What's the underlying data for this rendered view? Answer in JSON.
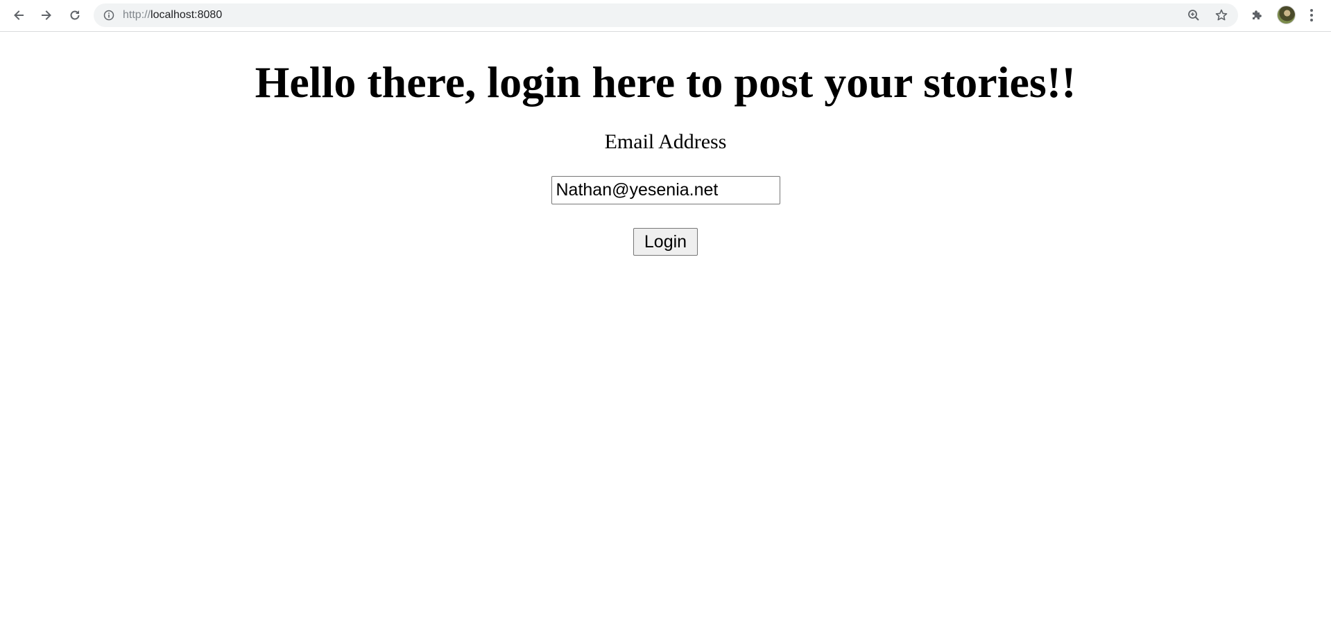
{
  "browser": {
    "url_prefix": "http://",
    "url_host": "localhost:8080",
    "icons": {
      "back": "arrow-left-icon",
      "forward": "arrow-right-icon",
      "reload": "reload-icon",
      "site_info": "info-icon",
      "zoom": "zoom-icon",
      "bookmark": "star-icon",
      "extensions": "puzzle-icon",
      "menu": "kebab-menu-icon"
    }
  },
  "page": {
    "title": "Hello there, login here to post your stories!!",
    "email_label": "Email Address",
    "email_value": "Nathan@yesenia.net",
    "login_label": "Login"
  },
  "colors": {
    "omnibox_bg": "#f1f3f4",
    "chrome_icon": "#5f6368",
    "button_bg": "#efefef"
  }
}
